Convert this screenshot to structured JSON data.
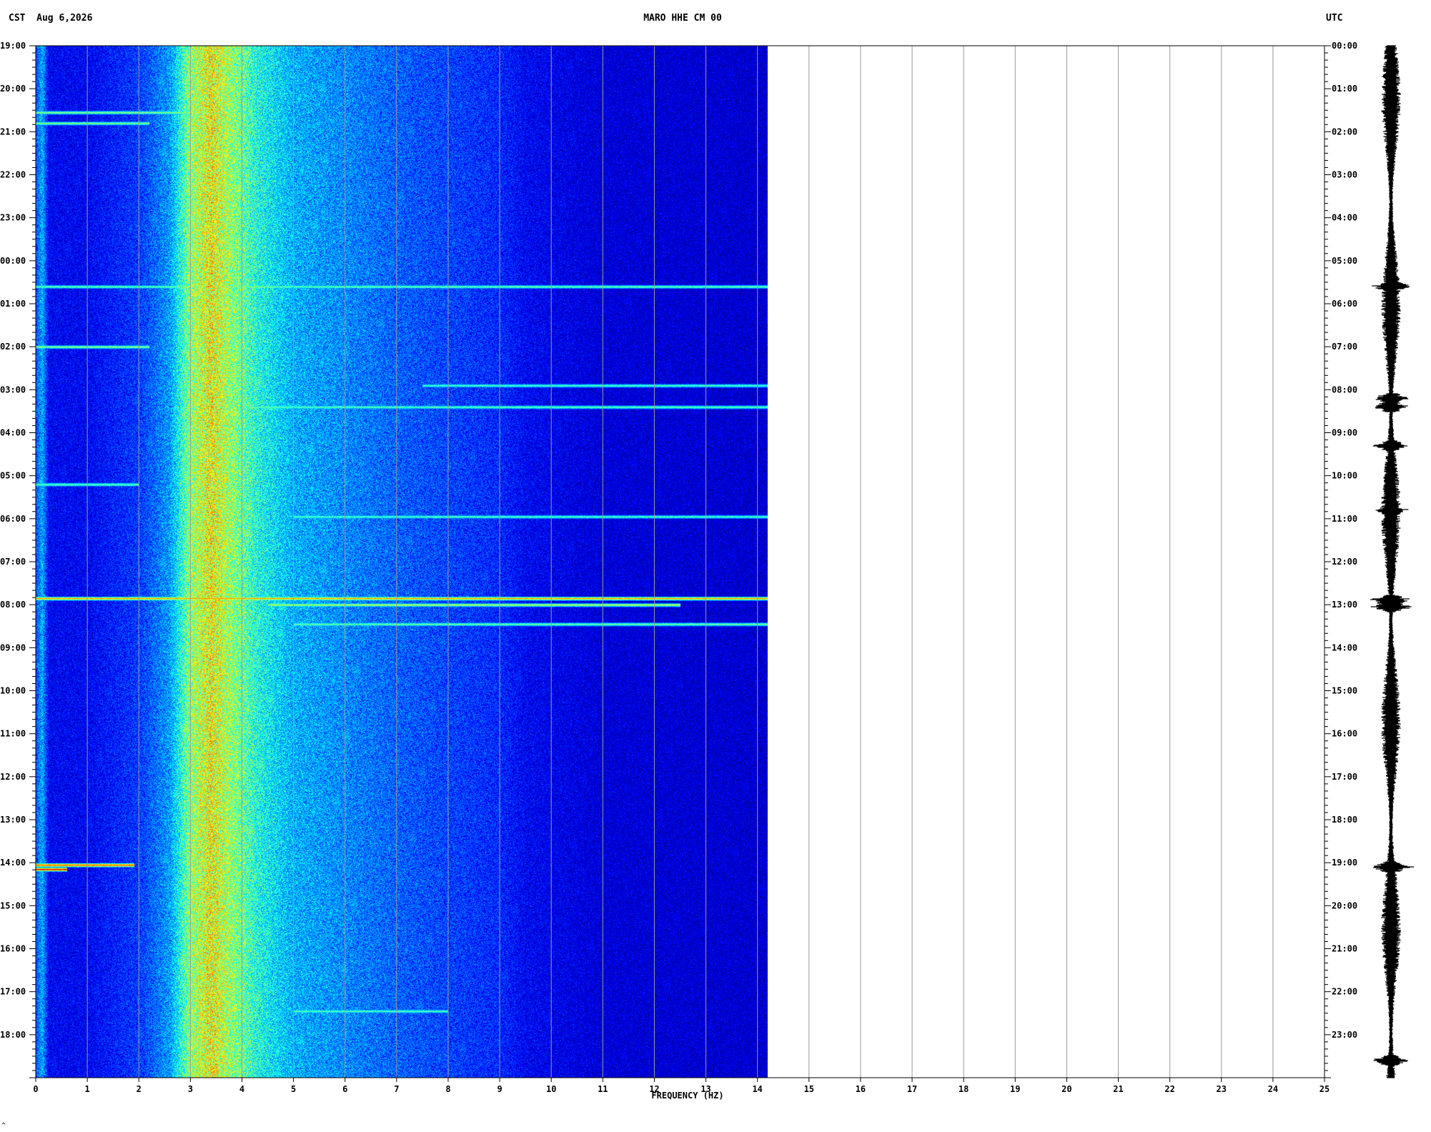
{
  "header": {
    "timezone_left": "CST",
    "date": "Aug 6,2026",
    "station": "MARO HHE CM 00",
    "timezone_right": "UTC"
  },
  "footer": {
    "mark": "^"
  },
  "chart_data": {
    "type": "heatmap",
    "title": "MARO HHE CM 00",
    "xlabel": "FREQUENCY (HZ)",
    "xlim": [
      0,
      25
    ],
    "x_ticks": [
      "0",
      "1",
      "2",
      "3",
      "4",
      "5",
      "6",
      "7",
      "8",
      "9",
      "10",
      "11",
      "12",
      "13",
      "14",
      "15",
      "16",
      "17",
      "18",
      "19",
      "20",
      "21",
      "22",
      "23",
      "24",
      "25"
    ],
    "data_max_frequency_hz": 14.2,
    "y_left_label": "CST",
    "y_left_ticks": [
      "19:00",
      "20:00",
      "21:00",
      "22:00",
      "23:00",
      "00:00",
      "01:00",
      "02:00",
      "03:00",
      "04:00",
      "05:00",
      "06:00",
      "07:00",
      "08:00",
      "09:00",
      "10:00",
      "11:00",
      "12:00",
      "13:00",
      "14:00",
      "15:00",
      "16:00",
      "17:00",
      "18:00"
    ],
    "y_right_label": "UTC",
    "y_right_ticks": [
      "00:00",
      "01:00",
      "02:00",
      "03:00",
      "04:00",
      "05:00",
      "06:00",
      "07:00",
      "08:00",
      "09:00",
      "10:00",
      "11:00",
      "12:00",
      "13:00",
      "14:00",
      "15:00",
      "16:00",
      "17:00",
      "18:00",
      "19:00",
      "20:00",
      "21:00",
      "22:00",
      "23:00"
    ],
    "duration_hours": 24,
    "colormap": [
      "#00007f",
      "#0000ff",
      "#007fff",
      "#00ffff",
      "#7fff7f",
      "#ffff00",
      "#ff7f00",
      "#ff0000",
      "#7f0000"
    ],
    "spectral_profile": [
      {
        "f": 0.0,
        "level": 0.2
      },
      {
        "f": 0.12,
        "level": 0.3
      },
      {
        "f": 0.25,
        "level": 0.12
      },
      {
        "f": 1.0,
        "level": 0.12
      },
      {
        "f": 2.0,
        "level": 0.18
      },
      {
        "f": 2.6,
        "level": 0.28
      },
      {
        "f": 3.0,
        "level": 0.52
      },
      {
        "f": 3.4,
        "level": 0.62
      },
      {
        "f": 3.8,
        "level": 0.52
      },
      {
        "f": 4.3,
        "level": 0.4
      },
      {
        "f": 5.0,
        "level": 0.3
      },
      {
        "f": 6.0,
        "level": 0.26
      },
      {
        "f": 7.0,
        "level": 0.22
      },
      {
        "f": 8.0,
        "level": 0.19
      },
      {
        "f": 9.0,
        "level": 0.16
      },
      {
        "f": 9.5,
        "level": 0.12
      },
      {
        "f": 11.0,
        "level": 0.09
      },
      {
        "f": 14.2,
        "level": 0.08
      }
    ],
    "events": [
      {
        "hour": 1.55,
        "f_start": 0,
        "f_end": 3.0,
        "level": 0.55
      },
      {
        "hour": 1.8,
        "f_start": 0,
        "f_end": 2.2,
        "level": 0.55
      },
      {
        "hour": 5.6,
        "f_start": 0,
        "f_end": 14.2,
        "level": 0.5
      },
      {
        "hour": 7.0,
        "f_start": 0,
        "f_end": 2.2,
        "level": 0.55
      },
      {
        "hour": 7.9,
        "f_start": 7.5,
        "f_end": 14.2,
        "level": 0.48
      },
      {
        "hour": 8.4,
        "f_start": 4.0,
        "f_end": 14.2,
        "level": 0.5
      },
      {
        "hour": 10.2,
        "f_start": 0,
        "f_end": 2.0,
        "level": 0.5
      },
      {
        "hour": 10.95,
        "f_start": 5.0,
        "f_end": 14.2,
        "level": 0.48
      },
      {
        "hour": 12.85,
        "f_start": 0,
        "f_end": 14.2,
        "level": 0.75
      },
      {
        "hour": 13.0,
        "f_start": 4.5,
        "f_end": 12.5,
        "level": 0.6
      },
      {
        "hour": 13.45,
        "f_start": 5.0,
        "f_end": 14.2,
        "level": 0.52
      },
      {
        "hour": 19.05,
        "f_start": 0,
        "f_end": 1.9,
        "level": 0.85
      },
      {
        "hour": 19.15,
        "f_start": 0,
        "f_end": 0.6,
        "level": 0.95
      },
      {
        "hour": 22.45,
        "f_start": 5.0,
        "f_end": 8.0,
        "level": 0.5
      }
    ],
    "trace_bursts": [
      {
        "hour": 5.6,
        "amplitude": 1.6
      },
      {
        "hour": 8.2,
        "amplitude": 1.3
      },
      {
        "hour": 8.4,
        "amplitude": 1.5
      },
      {
        "hour": 9.3,
        "amplitude": 1.4
      },
      {
        "hour": 10.8,
        "amplitude": 1.4
      },
      {
        "hour": 12.9,
        "amplitude": 2.0
      },
      {
        "hour": 13.05,
        "amplitude": 1.8
      },
      {
        "hour": 19.1,
        "amplitude": 1.8
      },
      {
        "hour": 23.6,
        "amplitude": 1.5
      }
    ]
  }
}
